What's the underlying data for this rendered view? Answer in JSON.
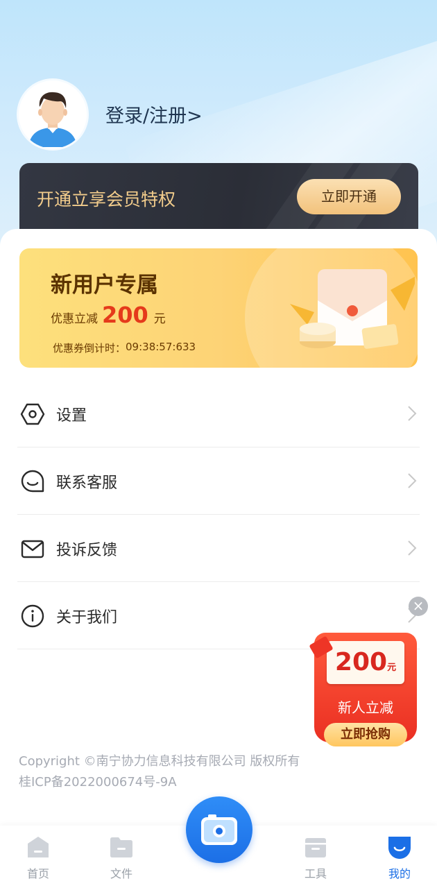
{
  "profile": {
    "login_text": "登录/注册>"
  },
  "vip": {
    "text": "开通立享会员特权",
    "button_label": "立即开通"
  },
  "coupon": {
    "title": "新用户专属",
    "sub_prefix": "优惠立减",
    "amount": "200",
    "unit": "元",
    "countdown_label": "优惠券倒计时：",
    "countdown_value": "09:38:57:633"
  },
  "menu": {
    "items": [
      {
        "label": "设置",
        "icon": "settings-icon"
      },
      {
        "label": "联系客服",
        "icon": "chat-icon"
      },
      {
        "label": "投诉反馈",
        "icon": "mail-icon"
      },
      {
        "label": "关于我们",
        "icon": "info-icon"
      }
    ]
  },
  "footer": {
    "copyright": "Copyright ©南宁协力信息科技有限公司 版权所有",
    "icp": "桂ICP备2022000674号-9A"
  },
  "promo": {
    "amount": "200",
    "unit": "元",
    "text": "新人立减",
    "button_label": "立即抢购",
    "close_symbol": "×"
  },
  "tabbar": {
    "tabs": [
      {
        "label": "首页",
        "icon": "home-icon",
        "active": false
      },
      {
        "label": "文件",
        "icon": "folder-icon",
        "active": false
      },
      {
        "label": "工具",
        "icon": "toolbox-icon",
        "active": false
      },
      {
        "label": "我的",
        "icon": "profile-icon",
        "active": true
      }
    ],
    "center_icon": "camera-icon"
  },
  "colors": {
    "accent": "#1b6fe6",
    "vip_gold": "#f3cd8c",
    "coupon_red": "#e53a1b"
  }
}
